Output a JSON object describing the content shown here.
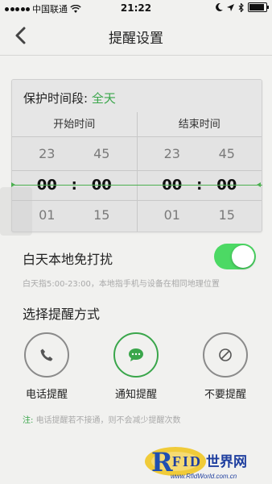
{
  "status": {
    "carrier": "中国联通",
    "time": "21:22"
  },
  "nav": {
    "title": "提醒设置"
  },
  "period": {
    "label": "保护时间段:",
    "value": "全天",
    "start": {
      "header": "开始时间",
      "prev": [
        "23",
        "45"
      ],
      "selected": [
        "00",
        "00"
      ],
      "next": [
        "01",
        "15"
      ]
    },
    "end": {
      "header": "结束时间",
      "prev": [
        "23",
        "45"
      ],
      "selected": [
        "00",
        "00"
      ],
      "next": [
        "01",
        "15"
      ]
    },
    "colon": ":"
  },
  "dnd": {
    "label": "白天本地免打扰",
    "enabled": true,
    "description": "白天指5:00-23:00，本地指手机与设备在相同地理位置"
  },
  "methods": {
    "title": "选择提醒方式",
    "items": [
      {
        "label": "电话提醒",
        "icon": "phone-icon"
      },
      {
        "label": "通知提醒",
        "icon": "chat-bubble-icon"
      },
      {
        "label": "不要提醒",
        "icon": "prohibited-icon"
      }
    ],
    "selected_index": 1
  },
  "note": {
    "prefix": "注:",
    "text": "电话提醒若不接通，则不会减少提醒次数"
  },
  "watermark": {
    "text": "RFID世界网",
    "url": "www.RfidWorld.com.cn"
  },
  "colors": {
    "accent": "#3aa64b",
    "toggle": "#4cd964"
  }
}
